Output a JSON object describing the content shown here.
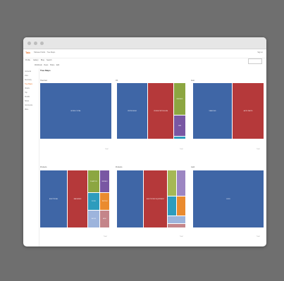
{
  "window": {
    "title": ""
  },
  "app": {
    "logo": "Tab",
    "title": "Tableau Public · Tree Maps",
    "user_link": "Sign in"
  },
  "menu": {
    "items": [
      "Profile",
      "Gallery",
      "Blog",
      "Search"
    ],
    "search_placeholder": ""
  },
  "toolbar": {
    "items": [
      "Workbook",
      "Views",
      "Share",
      "Edit"
    ]
  },
  "sidebar": {
    "items": [
      "Contents",
      "Files",
      "Summary",
      "Tree Maps",
      "Charts",
      "Top",
      "Details",
      "Notes",
      "Comments",
      "More"
    ]
  },
  "content": {
    "title": "Tree Maps"
  },
  "panels": [
    {
      "label": "Overview",
      "footer": "Total",
      "tiles": [
        {
          "label": "WORLD TOTAL",
          "color": "b"
        }
      ]
    },
    {
      "label": "Oil",
      "footer": "Total",
      "tiles": [
        {
          "label": "PETROLEUM",
          "color": "b"
        },
        {
          "label": "CRUDE PETROLEUM",
          "color": "r"
        },
        {
          "label": "REFINED",
          "color": "g"
        },
        {
          "label": "GAS",
          "color": "p"
        },
        {
          "label": "",
          "color": "t"
        }
      ]
    },
    {
      "label": "Auto",
      "footer": "Total",
      "tiles": [
        {
          "label": "VEHICLES",
          "color": "b"
        },
        {
          "label": "AUTO PARTS",
          "color": "r"
        }
      ]
    },
    {
      "label": "Products",
      "footer": "Total",
      "tiles": [
        {
          "label": "ELECTRICAL",
          "color": "b"
        },
        {
          "label": "MACHINES",
          "color": "r"
        },
        {
          "label": "PLASTICS",
          "color": "g"
        },
        {
          "label": "METALS",
          "color": "p"
        },
        {
          "label": "FOOD",
          "color": "t"
        },
        {
          "label": "TEXTILE",
          "color": "o"
        },
        {
          "label": "WOOD",
          "color": "lb"
        },
        {
          "label": "MISC",
          "color": "pk"
        }
      ]
    },
    {
      "label": "Products",
      "footer": "Total",
      "tiles": [
        {
          "label": "",
          "color": "b"
        },
        {
          "label": "ELECTRONIC EQUIPMENT",
          "color": "r"
        },
        {
          "label": "",
          "color": "ol"
        },
        {
          "label": "",
          "color": "lp"
        },
        {
          "label": "",
          "color": "t"
        },
        {
          "label": "",
          "color": "o"
        },
        {
          "label": "",
          "color": "lb"
        },
        {
          "label": "",
          "color": "pk"
        }
      ]
    },
    {
      "label": "Gold",
      "footer": "Total",
      "tiles": [
        {
          "label": "GOLD",
          "color": "b"
        }
      ]
    }
  ]
}
